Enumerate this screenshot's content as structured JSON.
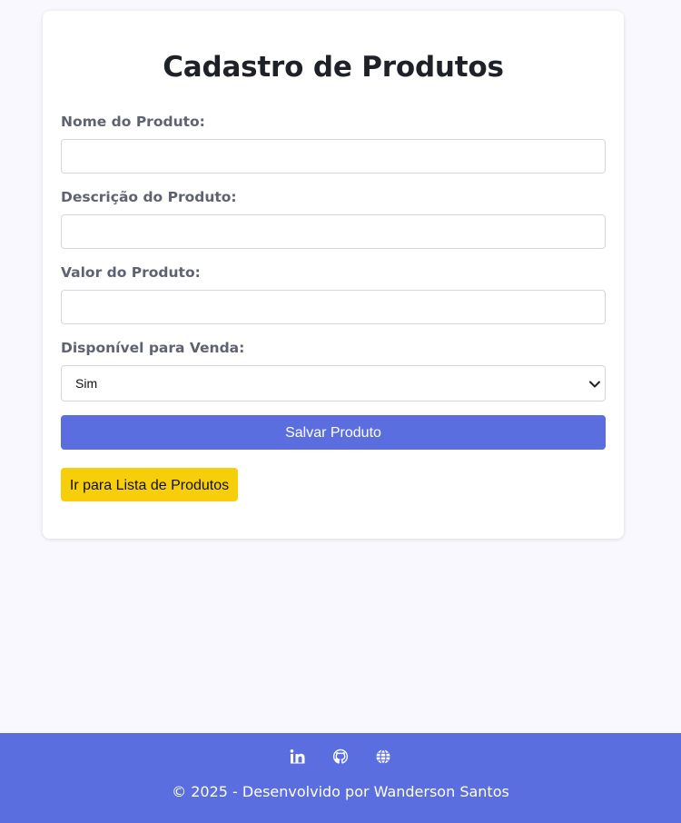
{
  "form": {
    "title": "Cadastro de Produtos",
    "fields": [
      {
        "label": "Nome do Produto:",
        "value": "",
        "placeholder": ""
      },
      {
        "label": "Descrição do Produto:",
        "value": "",
        "placeholder": ""
      },
      {
        "label": "Valor do Produto:",
        "value": "",
        "placeholder": ""
      }
    ],
    "availability": {
      "label": "Disponível para Venda:",
      "selected": "Sim"
    },
    "save_label": "Salvar Produto",
    "list_link_label": "Ir para Lista de Produtos"
  },
  "footer": {
    "icons": [
      "linkedin-icon",
      "github-icon",
      "globe-icon"
    ],
    "text": "© 2025 - Desenvolvido por Wanderson Santos"
  },
  "colors": {
    "background": "#f8f8fe",
    "primary": "#5a6ee0",
    "secondary_button": "#f6cf0a",
    "label": "#5f6270",
    "title": "#1f2128"
  }
}
